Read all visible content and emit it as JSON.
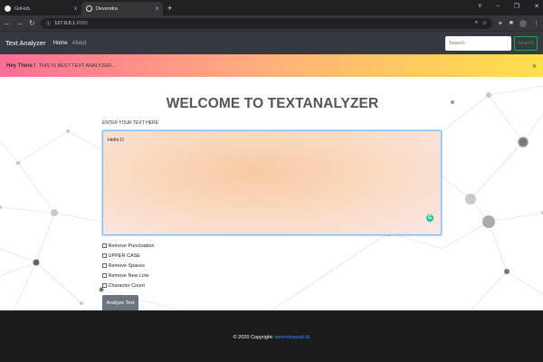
{
  "browser": {
    "tabs": [
      {
        "label": "GitHub",
        "close": "x"
      },
      {
        "label": "Devendra",
        "close": "x"
      }
    ],
    "new_tab": "+",
    "window_controls": [
      "v",
      "–",
      "❐",
      "✕"
    ],
    "url_host": "127.0.0.1",
    "url_port": ":8000"
  },
  "navbar": {
    "brand": "Text Analyzer",
    "links": [
      "Home",
      "About"
    ],
    "search_placeholder": "Search",
    "search_button": "Search"
  },
  "alert": {
    "strong": "Hey There !",
    "message": "THIS IS BEST TEXT ANALYZER...",
    "close": "×"
  },
  "main": {
    "title": "WELCOME TO TEXTANALYZER",
    "label": "ENTER YOUR TEXT HERE",
    "textarea_value": "Hello D",
    "grammarly_badge": "G",
    "options": [
      "Remove Punctuation",
      "UPPER CASE",
      "Remove Spaces",
      "Remove New Line",
      "Character Count"
    ],
    "submit": "Analyze Text"
  },
  "footer": {
    "text": "© 2020 Copyright:",
    "link": "devendrapatil.tk"
  },
  "colors": {
    "navbar": "#343a40",
    "alert_gradient": [
      "#ff6e96",
      "#ffb17a",
      "#ffe04a"
    ],
    "success": "#28a745",
    "button": "#6c757d",
    "footer": "#1c1c1c",
    "link": "#2e8bff"
  }
}
